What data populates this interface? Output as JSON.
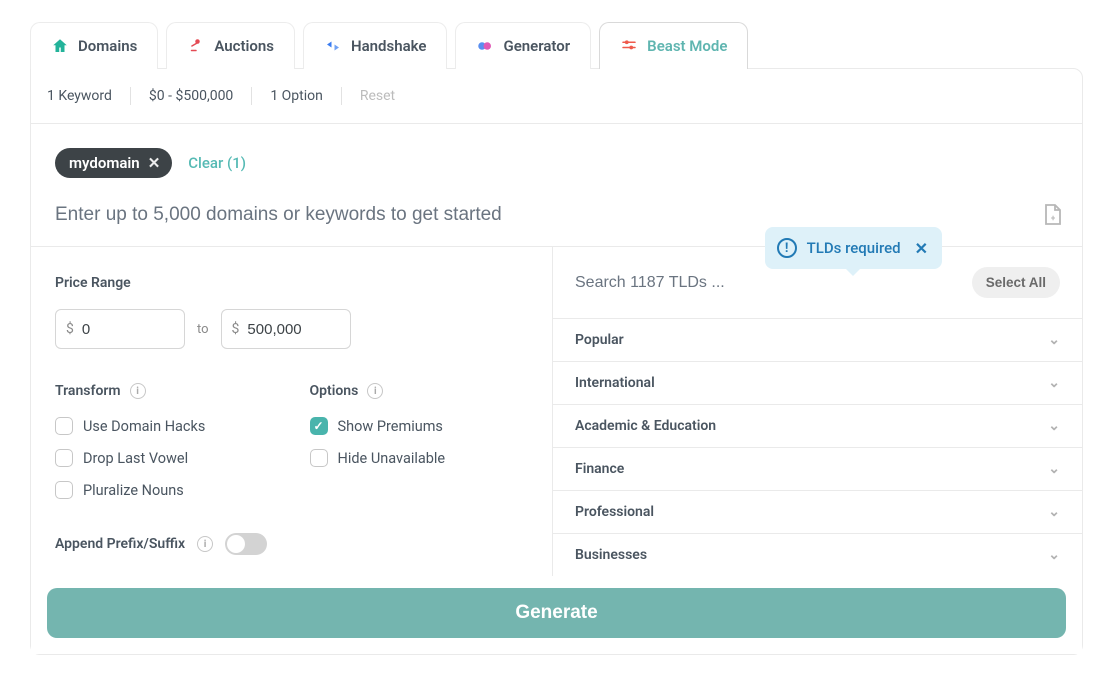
{
  "tabs": [
    {
      "id": "domains",
      "label": "Domains",
      "icon": "house-icon",
      "color": "#23b39a"
    },
    {
      "id": "auctions",
      "label": "Auctions",
      "icon": "gavel-icon",
      "color": "#e44b54"
    },
    {
      "id": "handshake",
      "label": "Handshake",
      "icon": "handshake-icon",
      "color": "#3a7cf0"
    },
    {
      "id": "generator",
      "label": "Generator",
      "icon": "generator-icon",
      "color": "#bd52d8"
    },
    {
      "id": "beast",
      "label": "Beast Mode",
      "icon": "sliders-icon",
      "color": "#ef5a4c",
      "active": true
    }
  ],
  "summary": {
    "keyword_count": "1 Keyword",
    "price_range": "$0 - $500,000",
    "option_count": "1 Option",
    "reset": "Reset"
  },
  "keywords": {
    "chip": "mydomain",
    "clear_label": "Clear (1)",
    "placeholder": "Enter up to 5,000 domains or keywords to get started"
  },
  "tooltip": {
    "text": "TLDs required"
  },
  "left": {
    "price_label": "Price Range",
    "price_min": "0",
    "price_to": "to",
    "price_max": "500,000",
    "transform_label": "Transform",
    "transform_items": [
      {
        "label": "Use Domain Hacks",
        "checked": false
      },
      {
        "label": "Drop Last Vowel",
        "checked": false
      },
      {
        "label": "Pluralize Nouns",
        "checked": false
      }
    ],
    "options_label": "Options",
    "options_items": [
      {
        "label": "Show Premiums",
        "checked": true
      },
      {
        "label": "Hide Unavailable",
        "checked": false
      }
    ],
    "append_label": "Append Prefix/Suffix"
  },
  "right": {
    "search_placeholder": "Search 1187 TLDs ...",
    "select_all": "Select All",
    "categories": [
      "Popular",
      "International",
      "Academic & Education",
      "Finance",
      "Professional",
      "Businesses"
    ]
  },
  "generate_label": "Generate"
}
